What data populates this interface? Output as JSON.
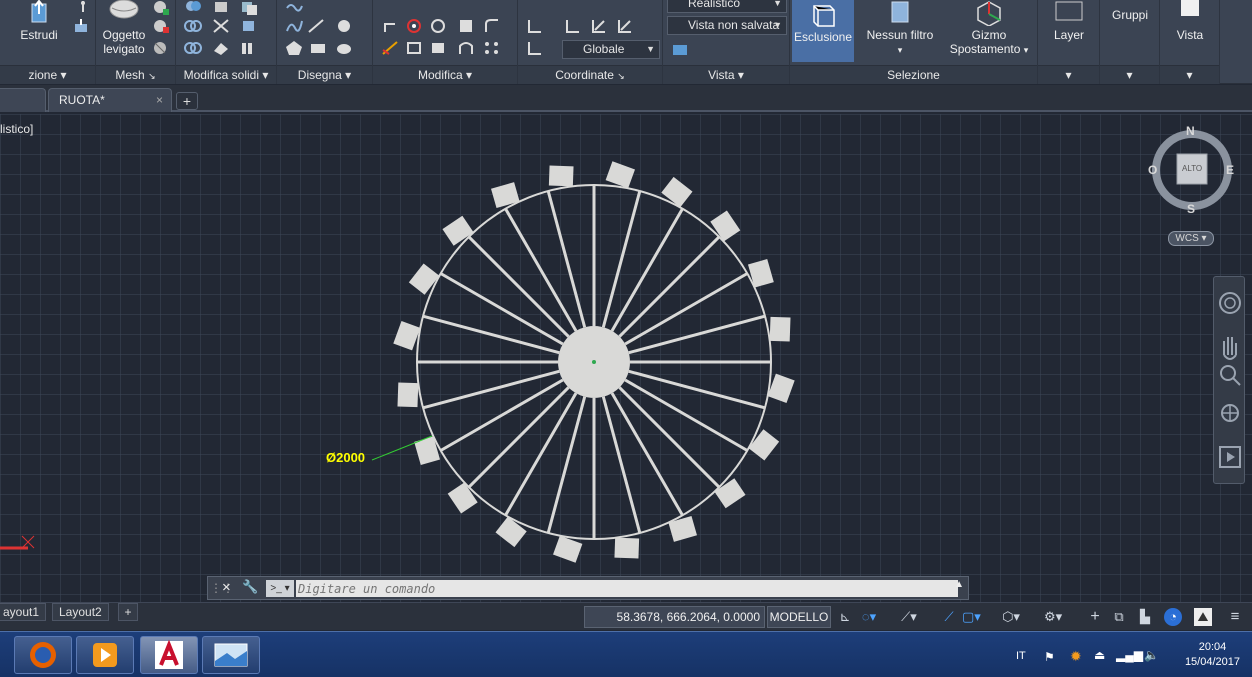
{
  "ribbon": {
    "panels": {
      "creazione": "zione",
      "mesh": "Mesh",
      "modifica_solidi": "Modifica solidi",
      "disegna": "Disegna",
      "modifica": "Modifica",
      "coordinate": "Coordinate",
      "vista": "Vista",
      "selezione": "Selezione"
    },
    "buttons": {
      "estrudi": "Estrudi",
      "oggetto_levigato_1": "Oggetto",
      "oggetto_levigato_2": "levigato",
      "esclusione": "Esclusione",
      "nessun_filtro": "Nessun filtro",
      "gizmo_1": "Gizmo",
      "gizmo_2": "Spostamento",
      "layer": "Layer",
      "gruppi": "Gruppi",
      "vista": "Vista"
    },
    "dropdowns": {
      "visual_style": "Realistico",
      "saved_view": "Vista non salvata",
      "coordinate_system": "Globale"
    }
  },
  "tabs": {
    "document": "RUOTA*"
  },
  "canvas": {
    "view_label": "listico]",
    "dimension": "Ø2000"
  },
  "viewcube": {
    "n": "N",
    "s": "S",
    "e": "E",
    "o": "O",
    "face": "ALTO",
    "wcs": "WCS"
  },
  "commandline": {
    "placeholder": "Digitare un comando"
  },
  "layouts": {
    "layout1": "ayout1",
    "layout2": "Layout2"
  },
  "status": {
    "coords": "58.3678, 666.2064, 0.0000",
    "space": "MODELLO"
  },
  "taskbar": {
    "lang": "IT",
    "time": "20:04",
    "date": "15/04/2017"
  },
  "colors": {
    "canvas_bg": "#222834",
    "ribbon_bg": "#3b4453",
    "wheel": "#d9d9d7",
    "dimension_text": "#ffff00",
    "dimension_line": "#33cc33",
    "taskbar": "#1d3e7a",
    "accent": "#4a6fa5"
  }
}
